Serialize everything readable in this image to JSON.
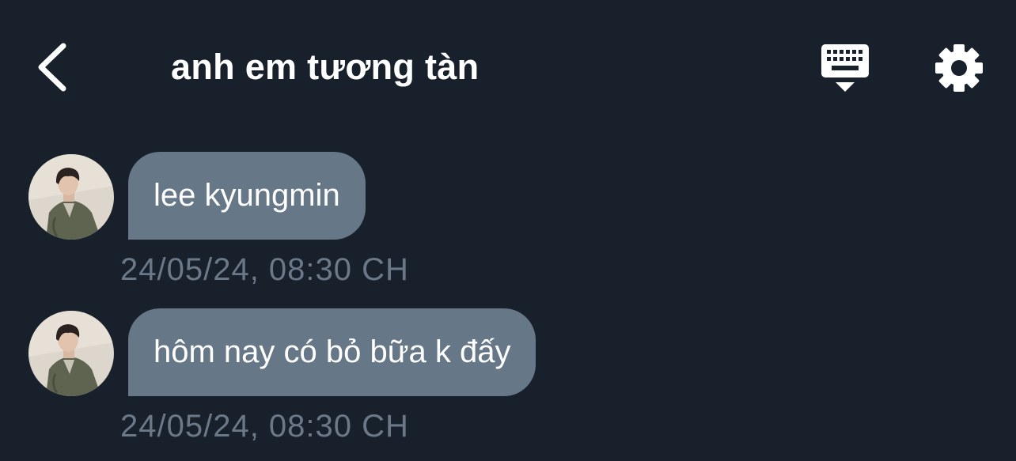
{
  "header": {
    "title": "anh em tương tàn",
    "back_icon": "chevron-left-icon",
    "keyboard_icon": "keyboard-icon",
    "settings_icon": "gear-icon"
  },
  "messages": [
    {
      "text": "lee kyungmin",
      "timestamp": "24/05/24, 08:30 CH"
    },
    {
      "text": "hôm nay có bỏ bữa k đấy",
      "timestamp": "24/05/24, 08:30 CH"
    }
  ],
  "colors": {
    "background": "#18202b",
    "bubble": "#667788",
    "timestamp": "#6b7888",
    "text": "#ffffff"
  }
}
